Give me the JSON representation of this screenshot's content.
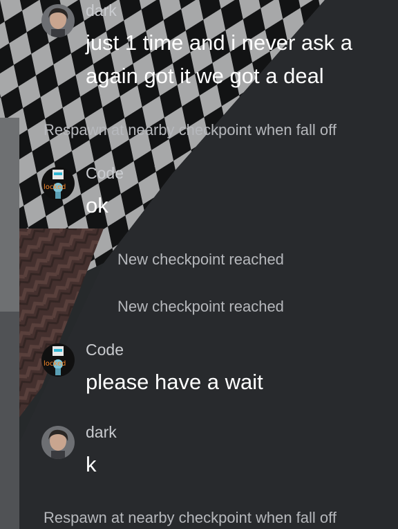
{
  "messages": [
    {
      "sender": "dark",
      "avatar": "dark-user-avatar",
      "lines": [
        "just 1 time and i never ask a",
        "again got it we got a deal"
      ]
    },
    {
      "sender": "Code",
      "avatar": "code-user-avatar",
      "lines": [
        "ok"
      ]
    },
    {
      "sender": "Code",
      "avatar": "code-user-avatar",
      "lines": [
        "please have a wait"
      ]
    },
    {
      "sender": "dark",
      "avatar": "dark-user-avatar",
      "lines": [
        "k"
      ]
    }
  ],
  "system_messages": [
    "Respawn at nearby checkpoint when fall off",
    "New checkpoint reached",
    "New checkpoint reached",
    "Respawn at nearby checkpoint when fall off"
  ],
  "avatar_labels": {
    "code": "locked"
  },
  "colors": {
    "panel": "#2f3134",
    "sender_name": "#c9cbcf",
    "message_text": "#ffffff",
    "system_text": "#b6b8bc",
    "checker_dark": "#111111",
    "checker_light": "#f4f4f4"
  }
}
